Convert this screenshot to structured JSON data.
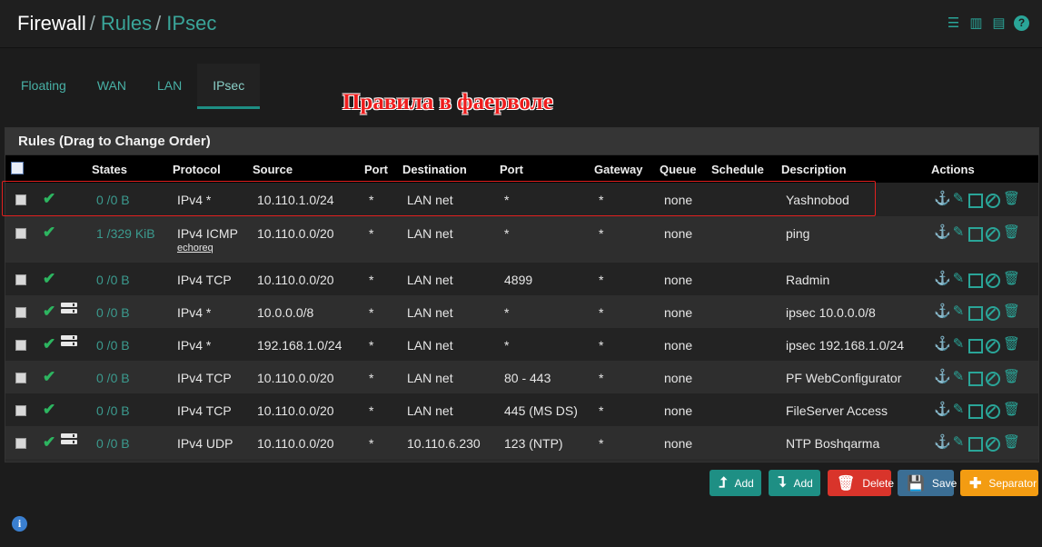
{
  "breadcrumb": {
    "root": "Firewall",
    "sep1": "/",
    "rules": "Rules",
    "sep2": "/",
    "current": "IPsec"
  },
  "top_icons": [
    "sliders-icon",
    "bar-chart-icon",
    "table-icon",
    "help-icon"
  ],
  "tabs": [
    {
      "label": "Floating",
      "active": false
    },
    {
      "label": "WAN",
      "active": false
    },
    {
      "label": "LAN",
      "active": false
    },
    {
      "label": "IPsec",
      "active": true
    }
  ],
  "overlay_title": "Правила в фаерволе",
  "panel_title": "Rules (Drag to Change Order)",
  "columns": {
    "states": "States",
    "protocol": "Protocol",
    "source": "Source",
    "port": "Port",
    "destination": "Destination",
    "dport": "Port",
    "gateway": "Gateway",
    "queue": "Queue",
    "schedule": "Schedule",
    "description": "Description",
    "actions": "Actions"
  },
  "rows": [
    {
      "states": "0 /0 B",
      "protocol": "IPv4 *",
      "protocol_sub": "",
      "source": "10.110.1.0/24",
      "port": "*",
      "destination": "LAN net",
      "dport": "*",
      "gateway": "*",
      "queue": "none",
      "schedule": "",
      "description": "Yashnobod",
      "server_icon": false,
      "highlighted": true
    },
    {
      "states": "1 /329 KiB",
      "protocol": "IPv4 ICMP",
      "protocol_sub": "echoreq",
      "source": "10.110.0.0/20",
      "port": "*",
      "destination": "LAN net",
      "dport": "*",
      "gateway": "*",
      "queue": "none",
      "schedule": "",
      "description": "ping",
      "server_icon": false,
      "highlighted": false
    },
    {
      "states": "0 /0 B",
      "protocol": "IPv4 TCP",
      "protocol_sub": "",
      "source": "10.110.0.0/20",
      "port": "*",
      "destination": "LAN net",
      "dport": "4899",
      "gateway": "*",
      "queue": "none",
      "schedule": "",
      "description": "Radmin",
      "server_icon": false,
      "highlighted": false
    },
    {
      "states": "0 /0 B",
      "protocol": "IPv4 *",
      "protocol_sub": "",
      "source": "10.0.0.0/8",
      "port": "*",
      "destination": "LAN net",
      "dport": "*",
      "gateway": "*",
      "queue": "none",
      "schedule": "",
      "description": "ipsec 10.0.0.0/8",
      "server_icon": true,
      "highlighted": false
    },
    {
      "states": "0 /0 B",
      "protocol": "IPv4 *",
      "protocol_sub": "",
      "source": "192.168.1.0/24",
      "port": "*",
      "destination": "LAN net",
      "dport": "*",
      "gateway": "*",
      "queue": "none",
      "schedule": "",
      "description": "ipsec 192.168.1.0/24",
      "server_icon": true,
      "highlighted": false
    },
    {
      "states": "0 /0 B",
      "protocol": "IPv4 TCP",
      "protocol_sub": "",
      "source": "10.110.0.0/20",
      "port": "*",
      "destination": "LAN net",
      "dport": "80 - 443",
      "gateway": "*",
      "queue": "none",
      "schedule": "",
      "description": "PF WebConfigurator",
      "server_icon": false,
      "highlighted": false
    },
    {
      "states": "0 /0 B",
      "protocol": "IPv4 TCP",
      "protocol_sub": "",
      "source": "10.110.0.0/20",
      "port": "*",
      "destination": "LAN net",
      "dport": "445 (MS DS)",
      "gateway": "*",
      "queue": "none",
      "schedule": "",
      "description": "FileServer Access",
      "server_icon": false,
      "highlighted": false
    },
    {
      "states": "0 /0 B",
      "protocol": "IPv4 UDP",
      "protocol_sub": "",
      "source": "10.110.0.0/20",
      "port": "*",
      "destination": "10.110.6.230",
      "dport": "123 (NTP)",
      "gateway": "*",
      "queue": "none",
      "schedule": "",
      "description": "NTP Boshqarma",
      "server_icon": true,
      "highlighted": false
    }
  ],
  "row_action_icons": [
    "anchor-icon",
    "pencil-icon",
    "copy-icon",
    "disable-icon",
    "trash-icon"
  ],
  "buttons": [
    {
      "label": "Add",
      "name": "add-top-button",
      "icon": "add-up-icon",
      "color": "#1e8f84"
    },
    {
      "label": "Add",
      "name": "add-bottom-button",
      "icon": "add-down-icon",
      "color": "#1e8f84"
    },
    {
      "label": "Delete",
      "name": "delete-button",
      "icon": "trash-icon",
      "color": "#d9342b"
    },
    {
      "label": "Save",
      "name": "save-button",
      "icon": "save-icon",
      "color": "#3b6e94"
    },
    {
      "label": "Separator",
      "name": "separator-button",
      "icon": "plus-icon",
      "color": "#f39c12"
    }
  ],
  "colors": {
    "accent": "#1e8f84",
    "link": "#3aa69a",
    "states": "#3b9a8e",
    "check": "#2db560",
    "highlight_border": "#e0201f"
  }
}
